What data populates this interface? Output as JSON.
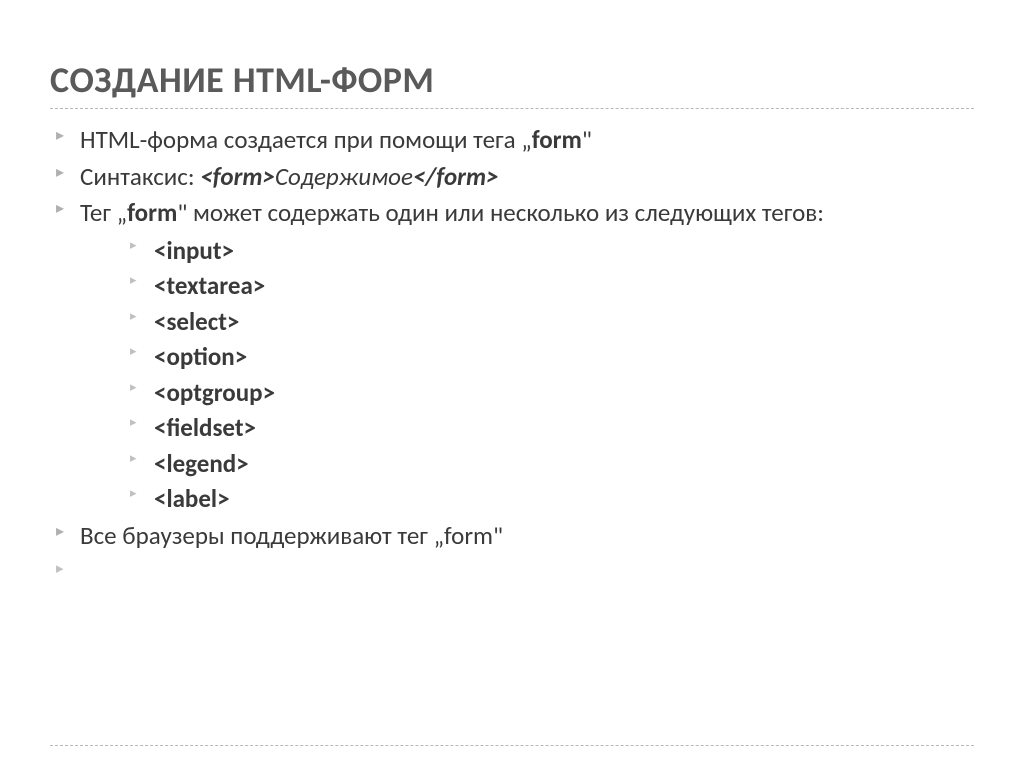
{
  "title": "СОЗДАНИЕ HTML-ФОРМ",
  "bullets": [
    {
      "prefix": "HTML-форма создается при помощи тега  „",
      "strong": "form",
      "suffix": "\""
    },
    {
      "prefix": "Синтаксис: ",
      "code_open": "<form>",
      "mid": "Содержимое",
      "code_close": "</form>"
    },
    {
      "prefix": "Тег  „",
      "strong": "form",
      "suffix": "\"  может содержать один или несколько из следующих тегов:"
    }
  ],
  "tags": [
    "<input>",
    "<textarea>",
    "<select>",
    "<option>",
    "<optgroup>",
    "<fieldset>",
    "<legend>",
    "<label>"
  ],
  "footer": {
    "prefix": "Все браузеры поддерживают тег  „",
    "strong": "form",
    "suffix": "\""
  }
}
